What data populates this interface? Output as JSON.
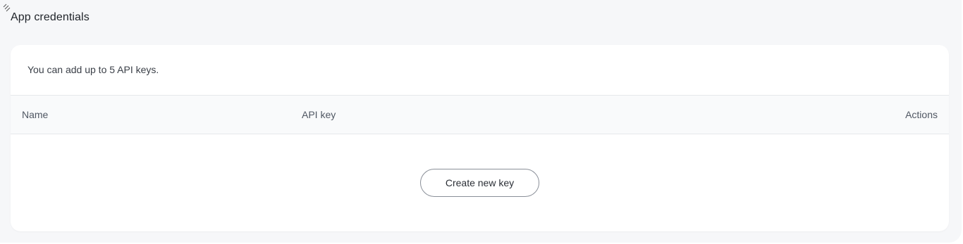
{
  "section": {
    "title": "App credentials"
  },
  "card": {
    "note": "You can add up to 5 API keys."
  },
  "table": {
    "columns": {
      "name": "Name",
      "api_key": "API key",
      "actions": "Actions"
    }
  },
  "actions": {
    "create_label": "Create new key"
  },
  "icons": {
    "corner": "resize-icon"
  },
  "colors": {
    "page_bg": "#f6f7f9",
    "card_bg": "#ffffff",
    "header_bg": "#f9fafb",
    "button_border": "#8a8f98"
  }
}
